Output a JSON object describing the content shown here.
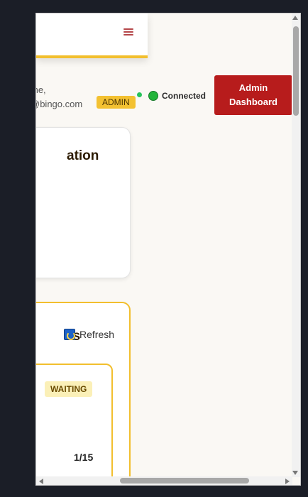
{
  "header": {
    "menu_icon": "hamburger-icon"
  },
  "user": {
    "welcome_line": "me,",
    "email_line": "@bingo.com",
    "role_badge": "ADMIN"
  },
  "status": {
    "text": "Connected",
    "color": "#22b43a"
  },
  "admin_button": {
    "line1": "Admin",
    "line2": "Dashboard"
  },
  "cards": {
    "card1_title": "ation",
    "card2_title": "es"
  },
  "refresh": {
    "label": "Refresh",
    "icon": "refresh-icon"
  },
  "game": {
    "status": "WAITING",
    "count": "1/15"
  },
  "colors": {
    "accent": "#f2bf2e",
    "primary": "#b71c1c"
  }
}
